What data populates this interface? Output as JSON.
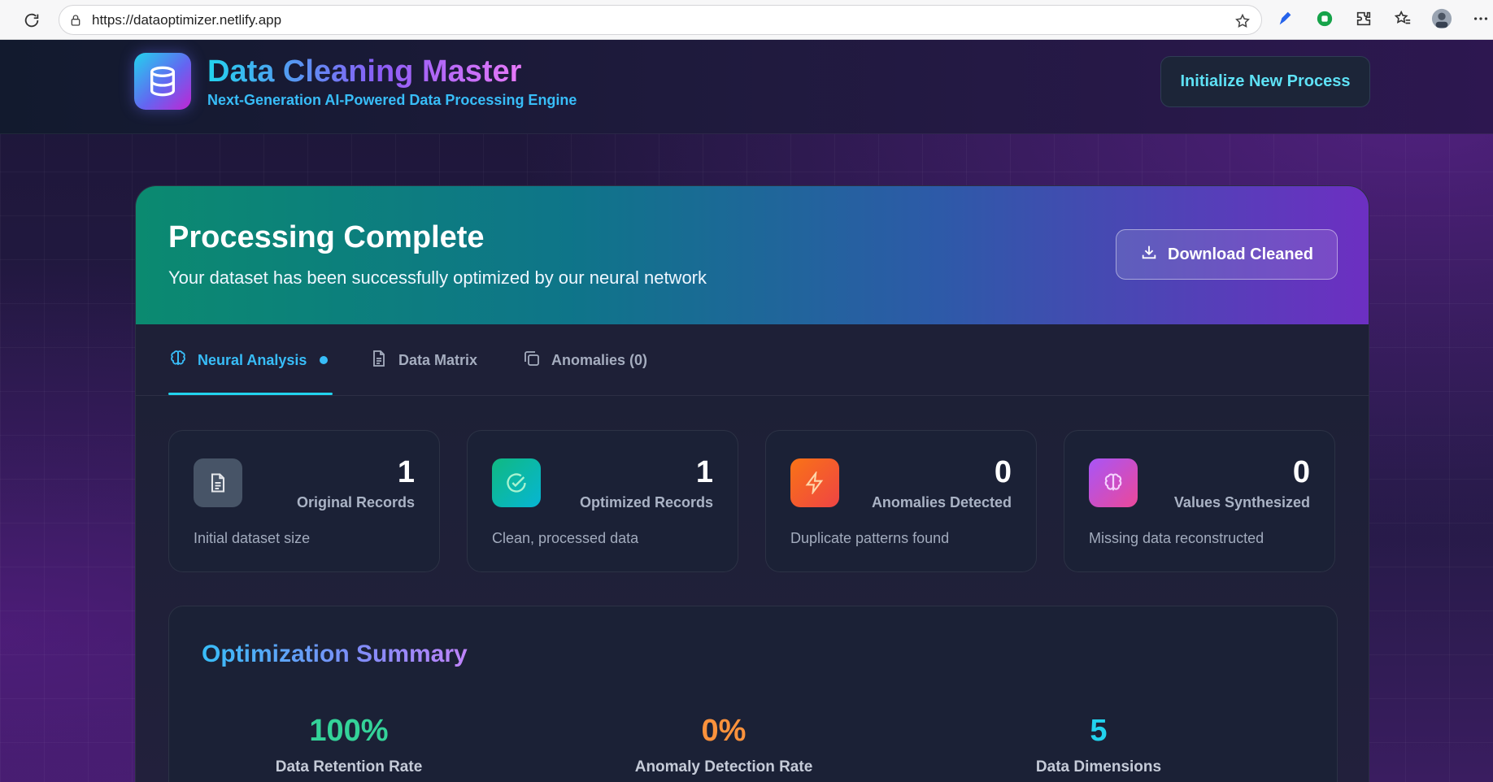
{
  "browser": {
    "url": "https://dataoptimizer.netlify.app"
  },
  "header": {
    "title": "Data Cleaning Master",
    "subtitle": "Next-Generation AI-Powered Data Processing Engine",
    "new_process_label": "Initialize New Process"
  },
  "banner": {
    "title": "Processing Complete",
    "subtitle": "Your dataset has been successfully optimized by our neural network",
    "download_label": "Download Cleaned"
  },
  "tabs": [
    {
      "label": "Neural Analysis",
      "icon": "brain-icon",
      "active": true
    },
    {
      "label": "Data Matrix",
      "icon": "document-icon",
      "active": false
    },
    {
      "label": "Anomalies (0)",
      "icon": "copy-icon",
      "active": false
    }
  ],
  "stats": [
    {
      "value": "1",
      "label": "Original Records",
      "desc": "Initial dataset size",
      "icon": "document-icon",
      "color": "#4b5563"
    },
    {
      "value": "1",
      "label": "Optimized Records",
      "desc": "Clean, processed data",
      "icon": "check-circle-icon",
      "color": "#10b981"
    },
    {
      "value": "0",
      "label": "Anomalies Detected",
      "desc": "Duplicate patterns found",
      "icon": "lightning-icon",
      "color": "#f97316"
    },
    {
      "value": "0",
      "label": "Values Synthesized",
      "desc": "Missing data reconstructed",
      "icon": "brain-icon",
      "color": "#c026d3"
    }
  ],
  "summary": {
    "title": "Optimization Summary",
    "metrics": [
      {
        "value": "100%",
        "label": "Data Retention Rate",
        "color": "#34d399"
      },
      {
        "value": "0%",
        "label": "Anomaly Detection Rate",
        "color": "#fb923c"
      },
      {
        "value": "5",
        "label": "Data Dimensions",
        "color": "#22d3ee"
      }
    ]
  }
}
